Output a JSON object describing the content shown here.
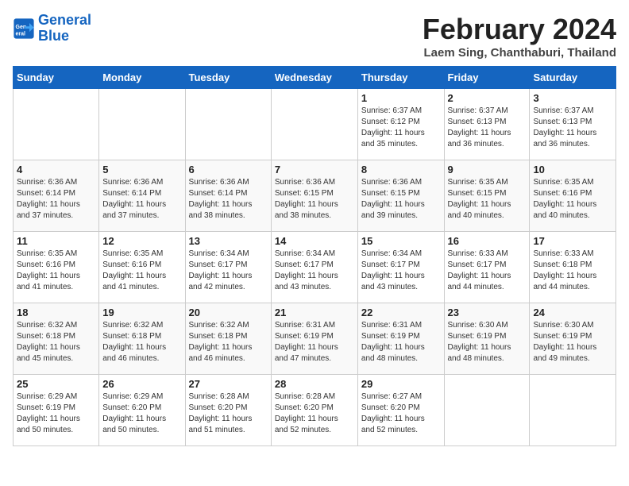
{
  "logo": {
    "line1": "General",
    "line2": "Blue"
  },
  "title": "February 2024",
  "subtitle": "Laem Sing, Chanthaburi, Thailand",
  "days_of_week": [
    "Sunday",
    "Monday",
    "Tuesday",
    "Wednesday",
    "Thursday",
    "Friday",
    "Saturday"
  ],
  "weeks": [
    [
      {
        "day": "",
        "info": ""
      },
      {
        "day": "",
        "info": ""
      },
      {
        "day": "",
        "info": ""
      },
      {
        "day": "",
        "info": ""
      },
      {
        "day": "1",
        "info": "Sunrise: 6:37 AM\nSunset: 6:12 PM\nDaylight: 11 hours\nand 35 minutes."
      },
      {
        "day": "2",
        "info": "Sunrise: 6:37 AM\nSunset: 6:13 PM\nDaylight: 11 hours\nand 36 minutes."
      },
      {
        "day": "3",
        "info": "Sunrise: 6:37 AM\nSunset: 6:13 PM\nDaylight: 11 hours\nand 36 minutes."
      }
    ],
    [
      {
        "day": "4",
        "info": "Sunrise: 6:36 AM\nSunset: 6:14 PM\nDaylight: 11 hours\nand 37 minutes."
      },
      {
        "day": "5",
        "info": "Sunrise: 6:36 AM\nSunset: 6:14 PM\nDaylight: 11 hours\nand 37 minutes."
      },
      {
        "day": "6",
        "info": "Sunrise: 6:36 AM\nSunset: 6:14 PM\nDaylight: 11 hours\nand 38 minutes."
      },
      {
        "day": "7",
        "info": "Sunrise: 6:36 AM\nSunset: 6:15 PM\nDaylight: 11 hours\nand 38 minutes."
      },
      {
        "day": "8",
        "info": "Sunrise: 6:36 AM\nSunset: 6:15 PM\nDaylight: 11 hours\nand 39 minutes."
      },
      {
        "day": "9",
        "info": "Sunrise: 6:35 AM\nSunset: 6:15 PM\nDaylight: 11 hours\nand 40 minutes."
      },
      {
        "day": "10",
        "info": "Sunrise: 6:35 AM\nSunset: 6:16 PM\nDaylight: 11 hours\nand 40 minutes."
      }
    ],
    [
      {
        "day": "11",
        "info": "Sunrise: 6:35 AM\nSunset: 6:16 PM\nDaylight: 11 hours\nand 41 minutes."
      },
      {
        "day": "12",
        "info": "Sunrise: 6:35 AM\nSunset: 6:16 PM\nDaylight: 11 hours\nand 41 minutes."
      },
      {
        "day": "13",
        "info": "Sunrise: 6:34 AM\nSunset: 6:17 PM\nDaylight: 11 hours\nand 42 minutes."
      },
      {
        "day": "14",
        "info": "Sunrise: 6:34 AM\nSunset: 6:17 PM\nDaylight: 11 hours\nand 43 minutes."
      },
      {
        "day": "15",
        "info": "Sunrise: 6:34 AM\nSunset: 6:17 PM\nDaylight: 11 hours\nand 43 minutes."
      },
      {
        "day": "16",
        "info": "Sunrise: 6:33 AM\nSunset: 6:17 PM\nDaylight: 11 hours\nand 44 minutes."
      },
      {
        "day": "17",
        "info": "Sunrise: 6:33 AM\nSunset: 6:18 PM\nDaylight: 11 hours\nand 44 minutes."
      }
    ],
    [
      {
        "day": "18",
        "info": "Sunrise: 6:32 AM\nSunset: 6:18 PM\nDaylight: 11 hours\nand 45 minutes."
      },
      {
        "day": "19",
        "info": "Sunrise: 6:32 AM\nSunset: 6:18 PM\nDaylight: 11 hours\nand 46 minutes."
      },
      {
        "day": "20",
        "info": "Sunrise: 6:32 AM\nSunset: 6:18 PM\nDaylight: 11 hours\nand 46 minutes."
      },
      {
        "day": "21",
        "info": "Sunrise: 6:31 AM\nSunset: 6:19 PM\nDaylight: 11 hours\nand 47 minutes."
      },
      {
        "day": "22",
        "info": "Sunrise: 6:31 AM\nSunset: 6:19 PM\nDaylight: 11 hours\nand 48 minutes."
      },
      {
        "day": "23",
        "info": "Sunrise: 6:30 AM\nSunset: 6:19 PM\nDaylight: 11 hours\nand 48 minutes."
      },
      {
        "day": "24",
        "info": "Sunrise: 6:30 AM\nSunset: 6:19 PM\nDaylight: 11 hours\nand 49 minutes."
      }
    ],
    [
      {
        "day": "25",
        "info": "Sunrise: 6:29 AM\nSunset: 6:19 PM\nDaylight: 11 hours\nand 50 minutes."
      },
      {
        "day": "26",
        "info": "Sunrise: 6:29 AM\nSunset: 6:20 PM\nDaylight: 11 hours\nand 50 minutes."
      },
      {
        "day": "27",
        "info": "Sunrise: 6:28 AM\nSunset: 6:20 PM\nDaylight: 11 hours\nand 51 minutes."
      },
      {
        "day": "28",
        "info": "Sunrise: 6:28 AM\nSunset: 6:20 PM\nDaylight: 11 hours\nand 52 minutes."
      },
      {
        "day": "29",
        "info": "Sunrise: 6:27 AM\nSunset: 6:20 PM\nDaylight: 11 hours\nand 52 minutes."
      },
      {
        "day": "",
        "info": ""
      },
      {
        "day": "",
        "info": ""
      }
    ]
  ]
}
